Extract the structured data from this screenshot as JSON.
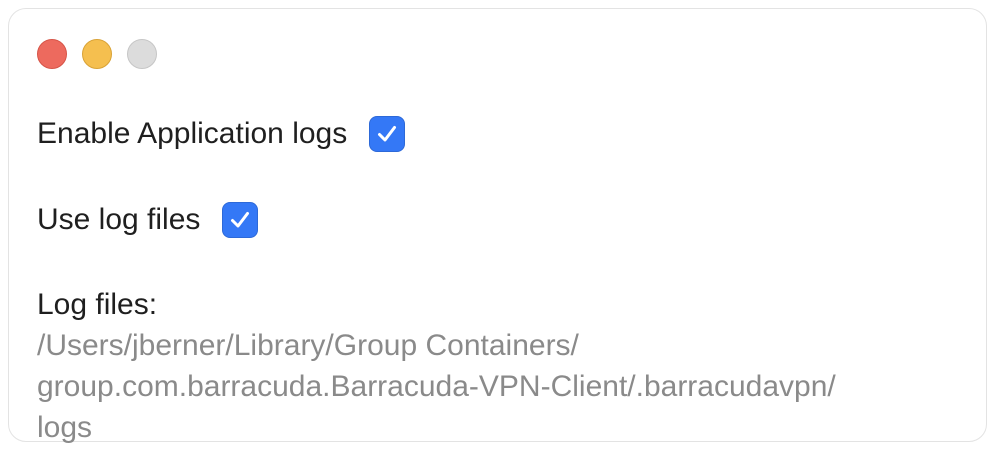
{
  "window": {
    "controls": [
      "close",
      "minimize",
      "zoom"
    ]
  },
  "settings": {
    "enable_app_logs": {
      "label": "Enable Application logs",
      "checked": true
    },
    "use_log_files": {
      "label": "Use log files",
      "checked": true
    }
  },
  "log_files": {
    "title": "Log files:",
    "path_line1": "/Users/jberner/Library/Group Containers/",
    "path_line2": "group.com.barracuda.Barracuda-VPN-Client/.barracudavpn/",
    "path_line3": "logs"
  },
  "colors": {
    "checkbox_blue": "#3478f6",
    "close": "#ed6a5e",
    "minimize": "#f5bf4f",
    "zoom": "#dcdcdc",
    "path_text": "#8a8a8a"
  }
}
